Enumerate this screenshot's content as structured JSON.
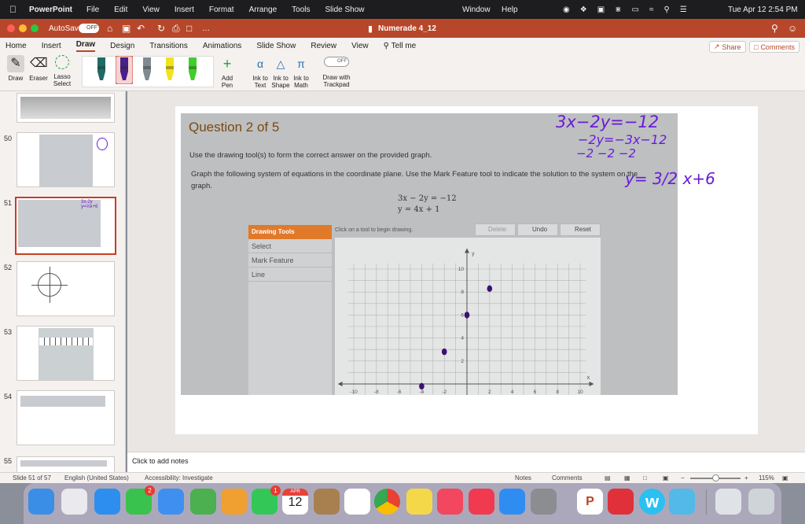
{
  "menubar": {
    "app_name": "PowerPoint",
    "items": [
      "File",
      "Edit",
      "View",
      "Insert",
      "Format",
      "Arrange",
      "Tools",
      "Slide Show"
    ],
    "right_items": [
      "Window",
      "Help"
    ],
    "clock": "Tue Apr 12  2:54 PM"
  },
  "titlebar": {
    "autosave_label": "AutoSave",
    "autosave_state": "OFF",
    "document_title": "Numerade 4_12",
    "more": "…"
  },
  "ribbon_tabs": [
    "Home",
    "Insert",
    "Draw",
    "Design",
    "Transitions",
    "Animations",
    "Slide Show",
    "Review",
    "View"
  ],
  "active_tab": "Draw",
  "tell_me": "Tell me",
  "share_label": "Share",
  "comments_label": "Comments",
  "draw_tools": {
    "draw": "Draw",
    "eraser": "Eraser",
    "lasso": "Lasso Select",
    "add_pen": "Add Pen",
    "ink_to_text": "Ink to Text",
    "ink_to_shape": "Ink to Shape",
    "ink_to_math": "Ink to Math",
    "trackpad_toggle": "OFF",
    "trackpad": "Draw with Trackpad"
  },
  "pens": [
    {
      "name": "pen-teal",
      "color": "#1f6b63"
    },
    {
      "name": "pen-purple",
      "color": "#4b1f8a"
    },
    {
      "name": "pencil-gray",
      "color": "#7f8a90"
    },
    {
      "name": "highlighter-yellow",
      "color": "#f2e21b"
    },
    {
      "name": "highlighter-green",
      "color": "#3fcf2a"
    }
  ],
  "slides": [
    {
      "num": "",
      "top": 0
    },
    {
      "num": "50"
    },
    {
      "num": "51",
      "selected": true
    },
    {
      "num": "52"
    },
    {
      "num": "53"
    },
    {
      "num": "54"
    },
    {
      "num": "55"
    }
  ],
  "slide": {
    "question_title": "Question 2 of 5",
    "instruction": "Use the drawing tool(s) to form the correct answer on the provided graph.",
    "prompt": "Graph the following system of equations in the coordinate plane. Use the Mark Feature tool to indicate the solution to the system on the graph.",
    "eq1": "3x − 2y = −12",
    "eq2": "y = 4x + 1",
    "panel_title": "Drawing Tools",
    "panel_items": [
      "Select",
      "Mark Feature",
      "Line"
    ],
    "hint": "Click on a tool to begin drawing.",
    "delete": "Delete",
    "undo": "Undo",
    "reset": "Reset",
    "x_ticks": [
      "-10",
      "-8",
      "-6",
      "-4",
      "-2",
      "2",
      "4",
      "6",
      "8",
      "10"
    ],
    "y_ticks": [
      "10",
      "8",
      "6",
      "4",
      "2"
    ],
    "x_axis": "x",
    "y_axis": "y",
    "points": [
      [
        2,
        8.3
      ],
      [
        0,
        6
      ],
      [
        -2,
        2.8
      ],
      [
        -4,
        -0.2
      ]
    ],
    "handwriting": [
      "3x−2y=−12",
      "−2y=−3x−12",
      "−2   −2  −2",
      "y= 3/2 x+6"
    ]
  },
  "notes_placeholder": "Click to add notes",
  "status": {
    "slide_count": "Slide 51 of 57",
    "language": "English (United States)",
    "accessibility": "Accessibility: Investigate",
    "notes": "Notes",
    "comments": "Comments",
    "zoom": "115%"
  },
  "dock": {
    "date_month": "APR",
    "date_day": "12",
    "badge_messages": "2",
    "badge_facetime": "1",
    "apps": [
      "finder",
      "launchpad",
      "safari",
      "messages",
      "mail",
      "maps",
      "photos",
      "facetime",
      "calendar",
      "contacts",
      "reminders",
      "chrome",
      "notes",
      "music",
      "news",
      "app-store",
      "system-preferences",
      "powerpoint",
      "email",
      "numerade",
      "quicktime",
      "preview",
      "trash"
    ]
  },
  "colors": {
    "accent": "#b7472a",
    "ink": "#6a1bd8",
    "point": "#3a1270"
  }
}
